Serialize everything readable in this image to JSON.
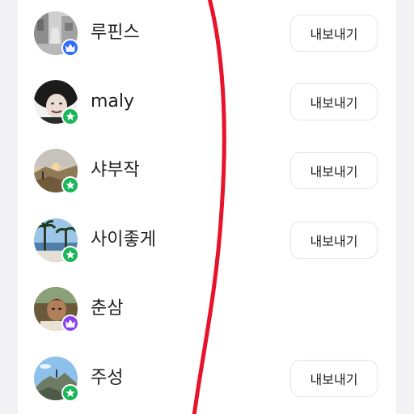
{
  "users": [
    {
      "name": "루핀스",
      "badge": "crown-icon",
      "badge_color": "#2f6bff",
      "export_label": "내보내기",
      "avatar": "avatar-street-photo"
    },
    {
      "name": "maly",
      "badge": "star-icon",
      "badge_color": "#19b65a",
      "export_label": "내보내기",
      "avatar": "avatar-portrait-bw"
    },
    {
      "name": "샤부작",
      "badge": "star-icon",
      "badge_color": "#19b65a",
      "export_label": "내보내기",
      "avatar": "avatar-sunset-landscape"
    },
    {
      "name": "사이좋게",
      "badge": "star-icon",
      "badge_color": "#19b65a",
      "export_label": "내보내기",
      "avatar": "avatar-palm-beach"
    },
    {
      "name": "춘삼",
      "badge": "crown-icon",
      "badge_color": "#8a3ff0",
      "export_label": "",
      "avatar": "avatar-man-portrait"
    },
    {
      "name": "주성",
      "badge": "star-icon",
      "badge_color": "#19b65a",
      "export_label": "내보내기",
      "avatar": "avatar-mountain-sky"
    }
  ],
  "colors": {
    "annotation_line": "#e8132a",
    "background": "#f2f2f4",
    "panel": "#ffffff"
  }
}
